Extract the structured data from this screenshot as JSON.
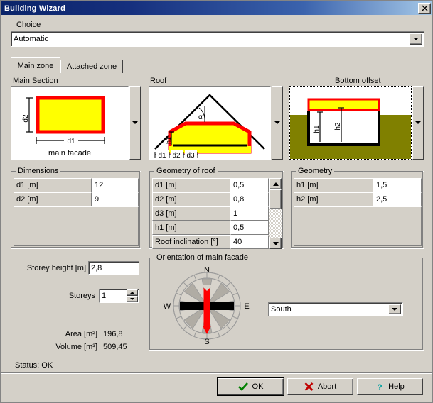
{
  "window": {
    "title": "Building Wizard",
    "close_label": "✕"
  },
  "choice": {
    "label": "Choice",
    "value": "Automatic"
  },
  "tabs": [
    {
      "label": "Main zone",
      "active": true
    },
    {
      "label": "Attached zone",
      "active": false
    }
  ],
  "main_section": {
    "title": "Main Section",
    "diagram": {
      "label_d2": "d2",
      "label_d1": "d1",
      "caption": "main facade"
    }
  },
  "roof_section": {
    "title": "Roof",
    "diagram": {
      "label_alpha": "α",
      "label_h1": "h1",
      "label_d1": "d1",
      "label_d2": "d2",
      "label_d3": "d3"
    }
  },
  "bottom_offset_section": {
    "title": "Bottom offset",
    "diagram": {
      "label_h1": "h1",
      "label_h2": "h2"
    }
  },
  "dimensions": {
    "title": "Dimensions",
    "rows": [
      {
        "label": "d1 [m]",
        "value": "12"
      },
      {
        "label": "d2 [m]",
        "value": "9"
      }
    ]
  },
  "geometry_of_roof": {
    "title": "Geometry of roof",
    "rows": [
      {
        "label": "d1 [m]",
        "value": "0,5"
      },
      {
        "label": "d2 [m]",
        "value": "0,8"
      },
      {
        "label": "d3 [m]",
        "value": "1"
      },
      {
        "label": "h1 [m]",
        "value": "0,5"
      },
      {
        "label": "Roof inclination [°]",
        "value": "40"
      }
    ]
  },
  "geometry": {
    "title": "Geometry",
    "rows": [
      {
        "label": "h1 [m]",
        "value": "1,5"
      },
      {
        "label": "h2 [m]",
        "value": "2,5"
      }
    ]
  },
  "storey": {
    "height_label": "Storey height [m]",
    "height_value": "2,8",
    "count_label": "Storeys",
    "count_value": "1"
  },
  "results": {
    "area_label": "Area [m²]",
    "area_value": "196,8",
    "volume_label": "Volume [m³]",
    "volume_value": "509,45"
  },
  "status": {
    "text": "Status: OK"
  },
  "orientation": {
    "title": "Orientation of main facade",
    "north": "N",
    "east": "E",
    "south": "S",
    "west": "W",
    "selected": "South"
  },
  "buttons": {
    "ok": "OK",
    "abort": "Abort",
    "help_prefix": "H",
    "help_rest": "elp"
  },
  "colors": {
    "title_bar_start": "#0a246a",
    "title_bar_end": "#a6c9e8",
    "face": "#d4d0c8",
    "yellow": "#ffff00",
    "red": "#ff0000",
    "ground": "#808000",
    "compass_red": "#ff0000",
    "ok_check": "#008000",
    "abort_x": "#c00000",
    "help_q": "#00a0a0"
  }
}
